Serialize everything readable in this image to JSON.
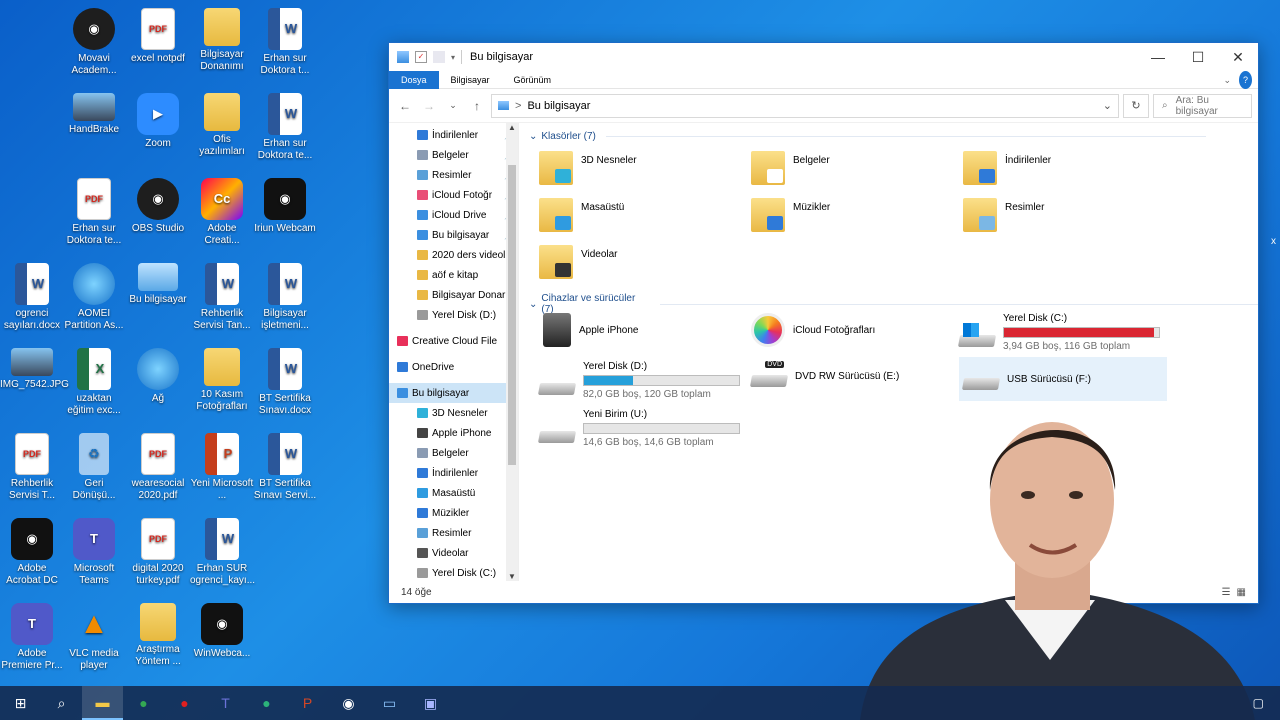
{
  "desktop": {
    "icons": [
      {
        "label": "Movavi Academ...",
        "kind": "round"
      },
      {
        "label": "excel notpdf",
        "kind": "pdf"
      },
      {
        "label": "Bilgisayar Donanımı",
        "kind": "folder"
      },
      {
        "label": "Erhan sur Doktora t...",
        "kind": "word"
      },
      {
        "label": "HandBrake",
        "kind": "img"
      },
      {
        "label": "Zoom",
        "kind": "blue"
      },
      {
        "label": "Ofis yazılımları",
        "kind": "folder"
      },
      {
        "label": "Erhan sur Doktora te...",
        "kind": "word"
      },
      {
        "label": "Erhan sur Doktora te...",
        "kind": "pdf"
      },
      {
        "label": "OBS Studio",
        "kind": "round"
      },
      {
        "label": "Adobe Creati...",
        "kind": "adobe"
      },
      {
        "label": "Iriun Webcam",
        "kind": "dark"
      },
      {
        "label": "ogrenci sayıları.docx",
        "kind": "word"
      },
      {
        "label": "AOMEI Partition As...",
        "kind": "globe"
      },
      {
        "label": "Bu bilgisayar",
        "kind": "pc"
      },
      {
        "label": "Rehberlik Servisi Tan...",
        "kind": "word"
      },
      {
        "label": "Bilgisayar işletmeni...",
        "kind": "word"
      },
      {
        "label": "IMG_7542.JPG",
        "kind": "img"
      },
      {
        "label": "uzaktan eğitim exc...",
        "kind": "excel"
      },
      {
        "label": "Ağ",
        "kind": "globe"
      },
      {
        "label": "10 Kasım Fotoğrafları",
        "kind": "folder"
      },
      {
        "label": "BT Sertifika Sınavı.docx",
        "kind": "word"
      },
      {
        "label": "Rehberlik Servisi T...",
        "kind": "pdf"
      },
      {
        "label": "Geri Dönüşü...",
        "kind": "recycle"
      },
      {
        "label": "wearesocial 2020.pdf",
        "kind": "pdf"
      },
      {
        "label": "Yeni Microsoft ...",
        "kind": "ppt"
      },
      {
        "label": "BT Sertifika Sınavı Servi...",
        "kind": "word"
      },
      {
        "label": "Adobe Acrobat DC",
        "kind": "dark"
      },
      {
        "label": "Microsoft Teams",
        "kind": "teams"
      },
      {
        "label": "digital 2020 turkey.pdf",
        "kind": "pdf"
      },
      {
        "label": "Erhan SUR ogrenci_kayı...",
        "kind": "word"
      },
      {
        "label": "Adobe Premiere Pr...",
        "kind": "teams"
      },
      {
        "label": "VLC media player",
        "kind": "vlc"
      },
      {
        "label": "Araştırma Yöntem ...",
        "kind": "folder"
      },
      {
        "label": "WinWebca...",
        "kind": "dark"
      }
    ],
    "icon_glyphs": {
      "pdf": "PDF",
      "word": "W",
      "excel": "X",
      "ppt": "P",
      "teams": "T",
      "vlc": "▲",
      "dark": "◉",
      "round": "◉",
      "blue": "▶",
      "adobe": "Cc",
      "recycle": "♻",
      "globe": "",
      "pc": "",
      "img": "",
      "folder": ""
    }
  },
  "window": {
    "title": "Bu bilgisayar",
    "controls": {
      "minimize": "—",
      "maximize": "☐",
      "close": "✕"
    },
    "ribbon_tabs": [
      {
        "label": "Dosya",
        "active": true
      },
      {
        "label": "Bilgisayar",
        "active": false
      },
      {
        "label": "Görünüm",
        "active": false
      }
    ],
    "ribbon_expand": "⌄",
    "help": "?",
    "address": {
      "path": "Bu bilgisayar",
      "separator": ">",
      "dropdown": "⌄"
    },
    "search_placeholder": "Ara: Bu bilgisayar",
    "nav_buttons": {
      "back": "←",
      "forward": "→",
      "recent": "⌄",
      "up": "↑",
      "refresh": "↻"
    },
    "nav_pane": [
      {
        "label": "İndirilenler",
        "color": "#2f7ad8",
        "pinned": true
      },
      {
        "label": "Belgeler",
        "color": "#8a9bb3",
        "pinned": true
      },
      {
        "label": "Resimler",
        "color": "#5aa0d8",
        "pinned": true
      },
      {
        "label": "iCloud Fotoğr",
        "color": "#e94e77",
        "pinned": true
      },
      {
        "label": "iCloud Drive",
        "color": "#3b8fe0",
        "pinned": true
      },
      {
        "label": "Bu bilgisayar",
        "color": "#3b8fe0",
        "pinned": true
      },
      {
        "label": "2020 ders videol",
        "color": "#e9b844",
        "pinned": false
      },
      {
        "label": "aöf e kitap",
        "color": "#e9b844",
        "pinned": false
      },
      {
        "label": "Bilgisayar Donar",
        "color": "#e9b844",
        "pinned": false
      },
      {
        "label": "Yerel Disk (D:)",
        "color": "#9a9a9a",
        "pinned": false
      },
      {
        "label": "",
        "color": "",
        "pinned": false
      },
      {
        "label": "Creative Cloud File",
        "color": "#e8305a",
        "pinned": false,
        "indent": 8
      },
      {
        "label": "",
        "color": "",
        "pinned": false
      },
      {
        "label": "OneDrive",
        "color": "#2f7ad8",
        "pinned": false,
        "indent": 8
      },
      {
        "label": "",
        "color": "",
        "pinned": false
      },
      {
        "label": "Bu bilgisayar",
        "color": "#3b8fe0",
        "pinned": false,
        "indent": 8,
        "selected": true
      },
      {
        "label": "3D Nesneler",
        "color": "#2fb1d9",
        "pinned": false
      },
      {
        "label": "Apple iPhone",
        "color": "#444444",
        "pinned": false
      },
      {
        "label": "Belgeler",
        "color": "#8a9bb3",
        "pinned": false
      },
      {
        "label": "İndirilenler",
        "color": "#2f7ad8",
        "pinned": false
      },
      {
        "label": "Masaüstü",
        "color": "#2f9be0",
        "pinned": false
      },
      {
        "label": "Müzikler",
        "color": "#2f7ad8",
        "pinned": false
      },
      {
        "label": "Resimler",
        "color": "#5aa0d8",
        "pinned": false
      },
      {
        "label": "Videolar",
        "color": "#555555",
        "pinned": false
      },
      {
        "label": "Yerel Disk (C:)",
        "color": "#9a9a9a",
        "pinned": false
      }
    ],
    "pin_glyph": "📌",
    "groups": {
      "folders": {
        "label": "Klasörler (7)",
        "chevron": "⌄"
      },
      "devices": {
        "label": "Cihazlar ve sürücüler (7)",
        "chevron": "⌄"
      }
    },
    "folders": [
      {
        "label": "3D Nesneler",
        "overlay": "#2fb1d9"
      },
      {
        "label": "Belgeler",
        "overlay": "#ffffff"
      },
      {
        "label": "İndirilenler",
        "overlay": "#2f7ad8"
      },
      {
        "label": "Masaüstü",
        "overlay": "#2f9be0"
      },
      {
        "label": "Müzikler",
        "overlay": "#2f7ad8"
      },
      {
        "label": "Resimler",
        "overlay": "#7bb7e5"
      },
      {
        "label": "Videolar",
        "overlay": "#333333"
      }
    ],
    "devices": [
      {
        "label": "Apple iPhone",
        "kind": "phone"
      },
      {
        "label": "iCloud Fotoğrafları",
        "kind": "photos"
      },
      {
        "label": "Yerel Disk (C:)",
        "kind": "disk",
        "used_fraction": 0.966,
        "bar_color": "#da2632",
        "info": "3,94 GB boş, 116 GB toplam"
      },
      {
        "label": "Yerel Disk (D:)",
        "kind": "disk",
        "used_fraction": 0.317,
        "bar_color": "#26a0da",
        "info": "82,0 GB boş, 120 GB toplam"
      },
      {
        "label": "DVD RW Sürücüsü (E:)",
        "kind": "dvd",
        "dvd_text": "DVD"
      },
      {
        "label": "USB Sürücüsü (F:)",
        "kind": "usb"
      },
      {
        "label": "Yeni Birim (U:)",
        "kind": "disk",
        "used_fraction": 0.0,
        "bar_color": "#26a0da",
        "info": "14,6 GB boş, 14,6 GB toplam"
      }
    ],
    "status": {
      "count": "14 öğe",
      "views": [
        "☰",
        "▦"
      ]
    }
  },
  "taskbar": {
    "items": [
      {
        "name": "start",
        "glyph": "⊞",
        "color": "#ffffff"
      },
      {
        "name": "search",
        "glyph": "⌕",
        "color": "#ffffff"
      },
      {
        "name": "file-explorer",
        "glyph": "▬",
        "color": "#f3c948",
        "active": true
      },
      {
        "name": "chrome",
        "glyph": "●",
        "color": "#34a853"
      },
      {
        "name": "opera",
        "glyph": "●",
        "color": "#e02020"
      },
      {
        "name": "teams",
        "glyph": "T",
        "color": "#6b72d8"
      },
      {
        "name": "edge",
        "glyph": "●",
        "color": "#2cb37a"
      },
      {
        "name": "powerpoint",
        "glyph": "P",
        "color": "#d24726"
      },
      {
        "name": "obs",
        "glyph": "◉",
        "color": "#ffffff"
      },
      {
        "name": "network-app",
        "glyph": "▭",
        "color": "#8fc7ff"
      },
      {
        "name": "program-app",
        "glyph": "▣",
        "color": "#a8b6ff"
      }
    ],
    "notification_glyph": "▢"
  },
  "edge_fragment": "x"
}
